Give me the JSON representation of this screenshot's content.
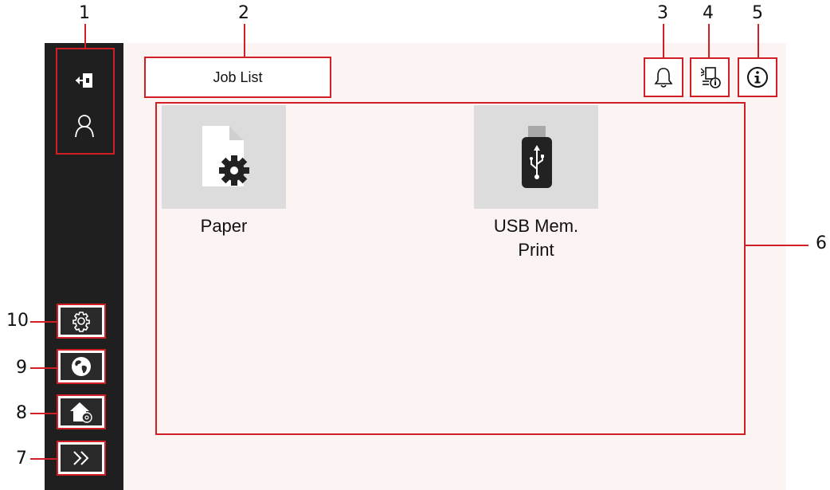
{
  "callouts": {
    "n1": "1",
    "n2": "2",
    "n3": "3",
    "n4": "4",
    "n5": "5",
    "n6": "6",
    "n7": "7",
    "n8": "8",
    "n9": "9",
    "n10": "10"
  },
  "header": {
    "job_list_label": "Job List"
  },
  "tiles": {
    "paper": {
      "label": "Paper",
      "icon": "paper-settings-icon"
    },
    "usb": {
      "label_line1": "USB Mem.",
      "label_line2": "Print",
      "icon": "usb-memory-icon"
    }
  },
  "colors": {
    "callout_red": "#d11f25",
    "sidebar": "#1f1f1f",
    "content_bg": "#fcf3f3",
    "tile_bg": "#dcdcdc"
  }
}
